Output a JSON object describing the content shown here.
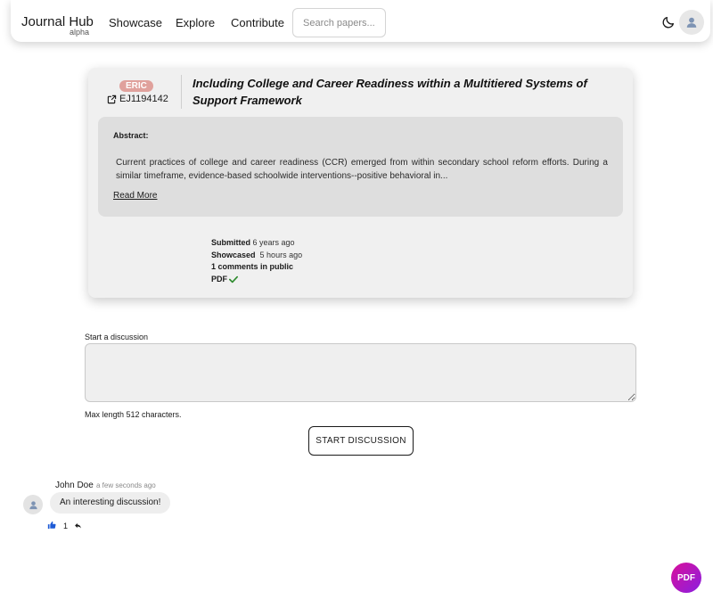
{
  "nav": {
    "brand": "Journal Hub",
    "brand_sub": "alpha",
    "links": [
      "Showcase",
      "Explore",
      "Contribute"
    ],
    "search_placeholder": "Search papers..."
  },
  "paper": {
    "source_badge": "ERIC",
    "id": "EJ1194142",
    "title": "Including College and Career Readiness within a Multitiered Systems of Support Framework",
    "abstract_label": "Abstract:",
    "abstract": "Current practices of college and career readiness (CCR) emerged from within secondary school reform efforts. During a similar timeframe, evidence-based schoolwide interventions--positive behavioral in...",
    "read_more": "Read More",
    "meta": {
      "submitted_label": "Submitted",
      "submitted_value": "6 years ago",
      "showcased_label": "Showcased",
      "showcased_value": "5 hours ago",
      "comments": "1 comments in public",
      "pdf_label": "PDF"
    }
  },
  "discussion": {
    "label": "Start a discussion",
    "maxlen": "Max length 512 characters.",
    "button": "START DISCUSSION"
  },
  "comment": {
    "author": "John Doe",
    "time": "a few seconds ago",
    "text": "An interesting discussion!",
    "likes": "1"
  },
  "fab": {
    "label": "PDF"
  },
  "colors": {
    "badge": "#e0a19c",
    "check": "#2e8b2e",
    "like": "#1e5bd6",
    "fab_start": "#d9109b",
    "fab_end": "#8a1fe0"
  },
  "icons": [
    "moon-icon",
    "user-icon",
    "external-link-icon",
    "check-icon",
    "thumbs-up-icon",
    "reply-icon"
  ]
}
